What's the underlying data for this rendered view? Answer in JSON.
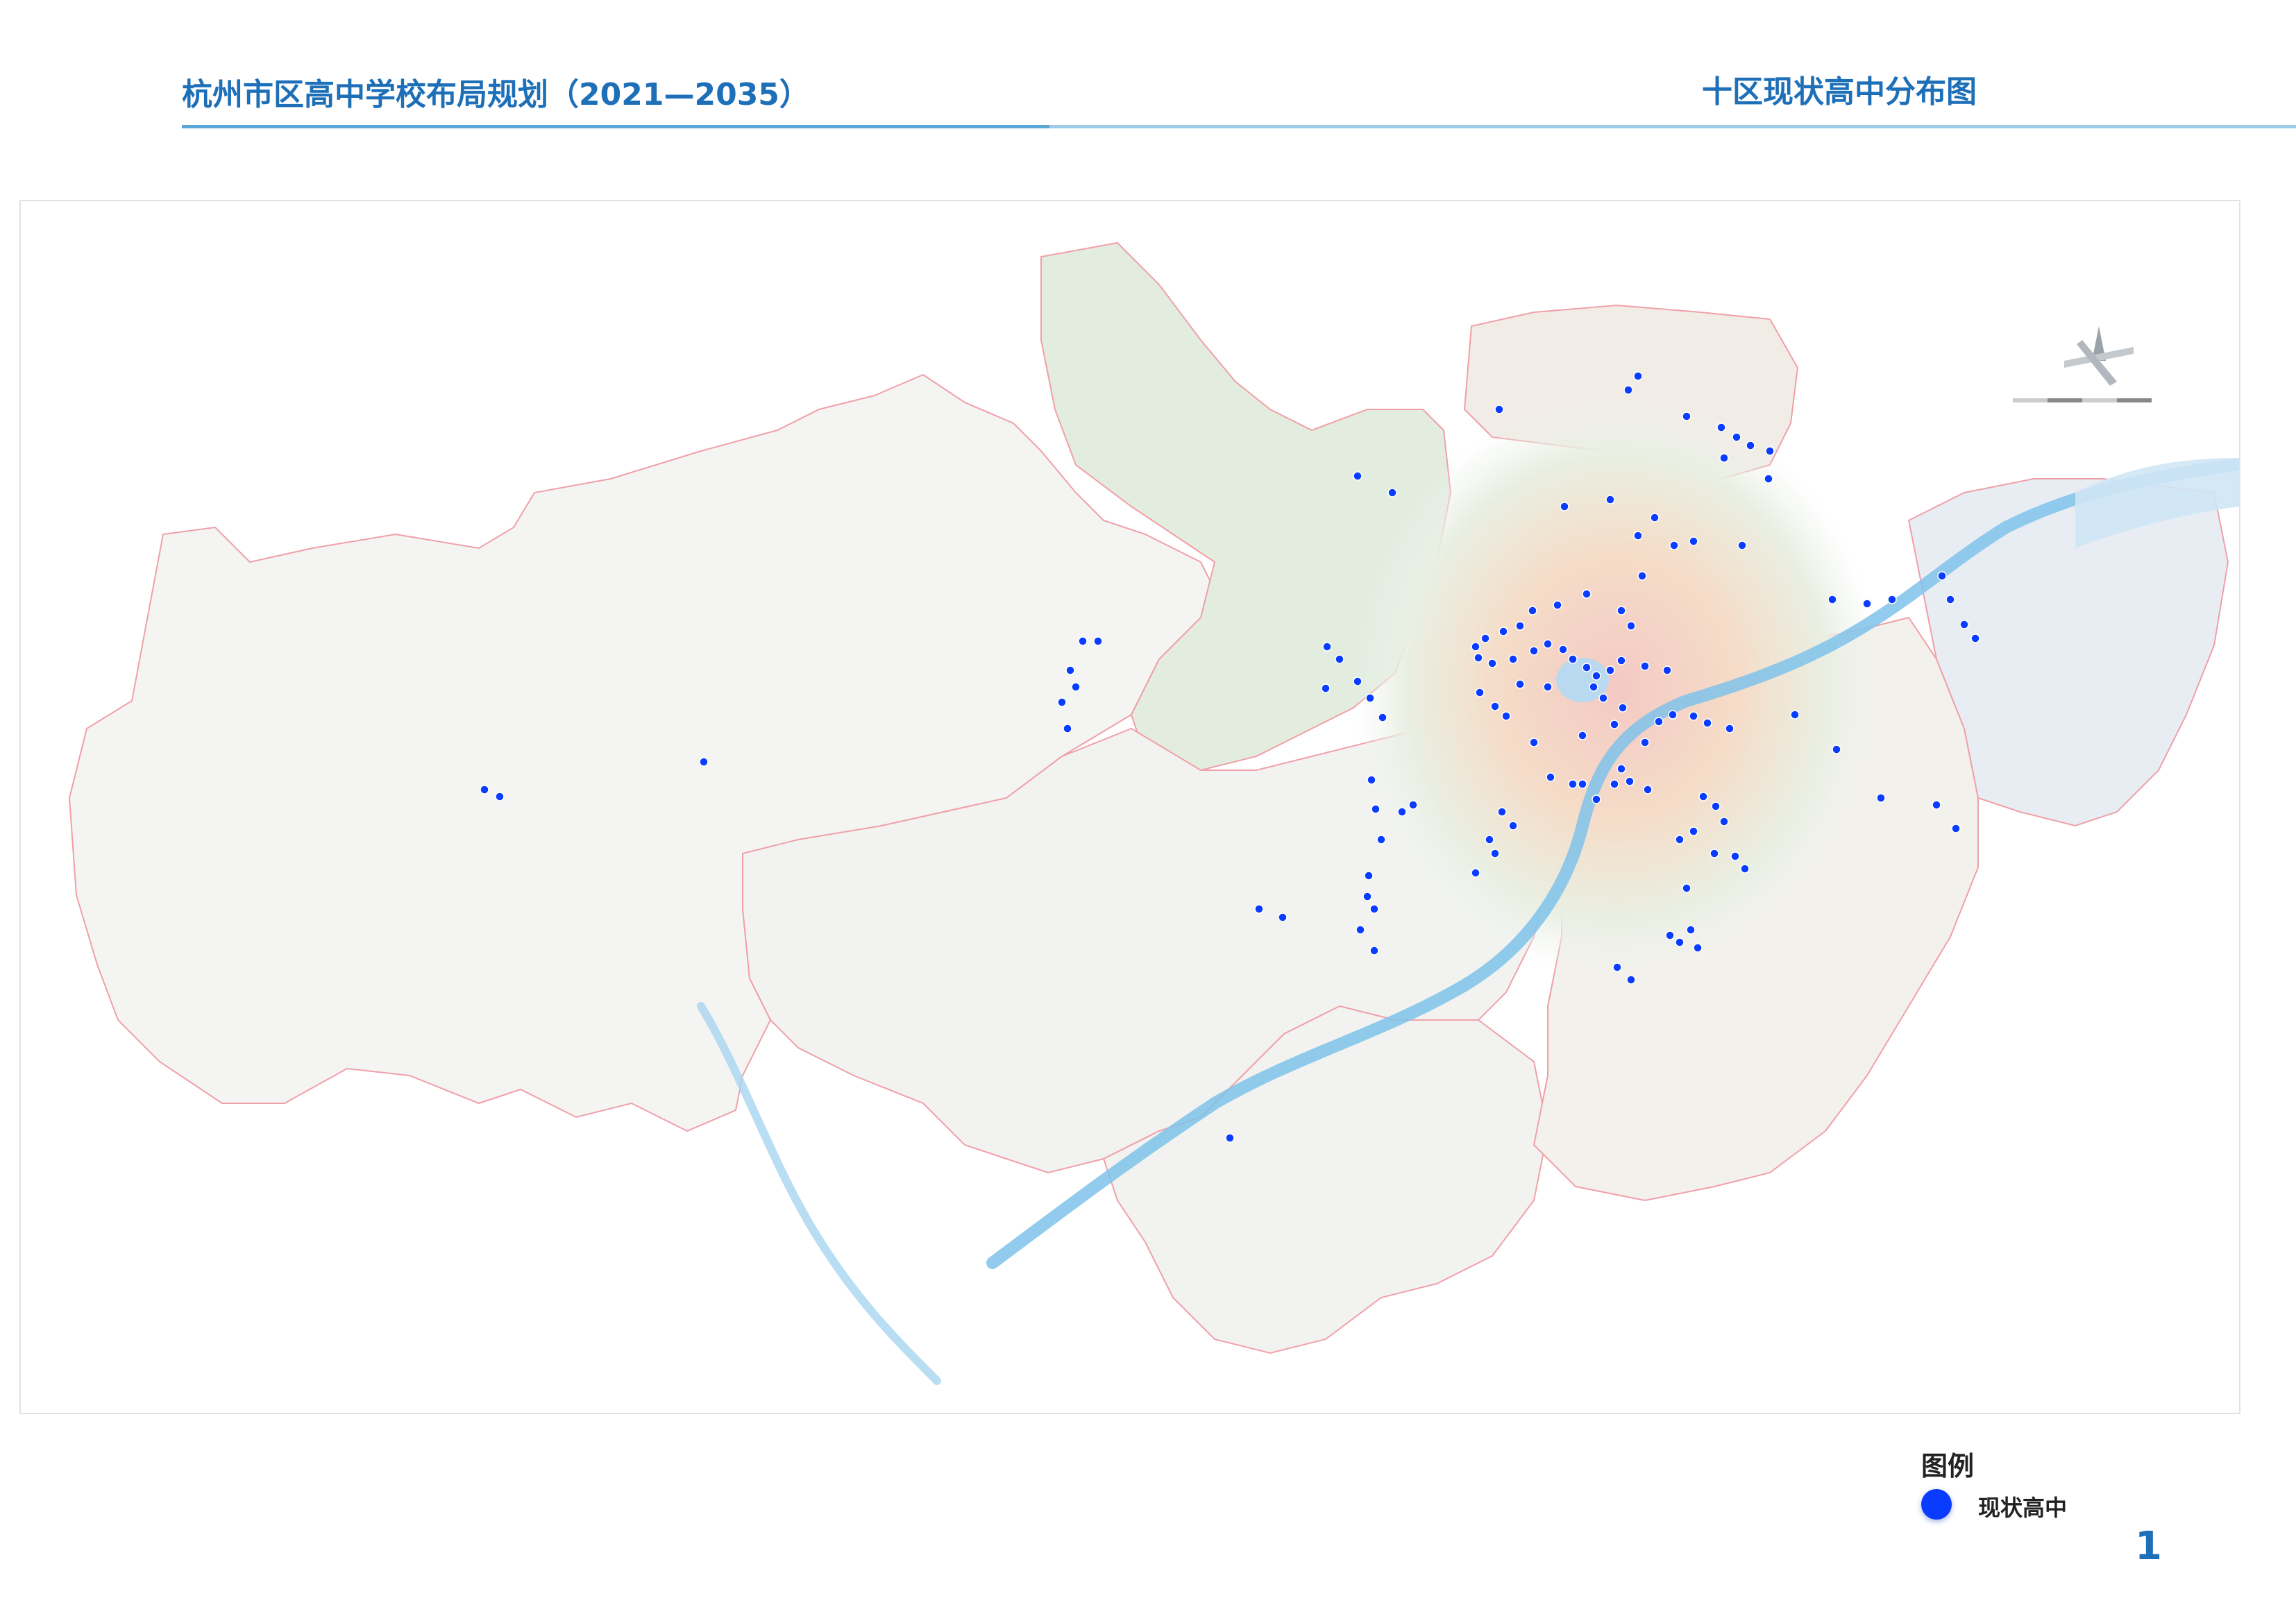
{
  "header": {
    "title": "杭州市区高中学校布局规划（2021—2035）",
    "map_title": "十区现状高中分布图"
  },
  "legend": {
    "heading": "图例",
    "item_label": "现状高中",
    "marker_color": "#0a3cff"
  },
  "page_number": "1",
  "colors": {
    "brand_blue": "#1d6fb8",
    "district_boundary": "#f0a0a8",
    "river": "#7fc2ea"
  }
}
